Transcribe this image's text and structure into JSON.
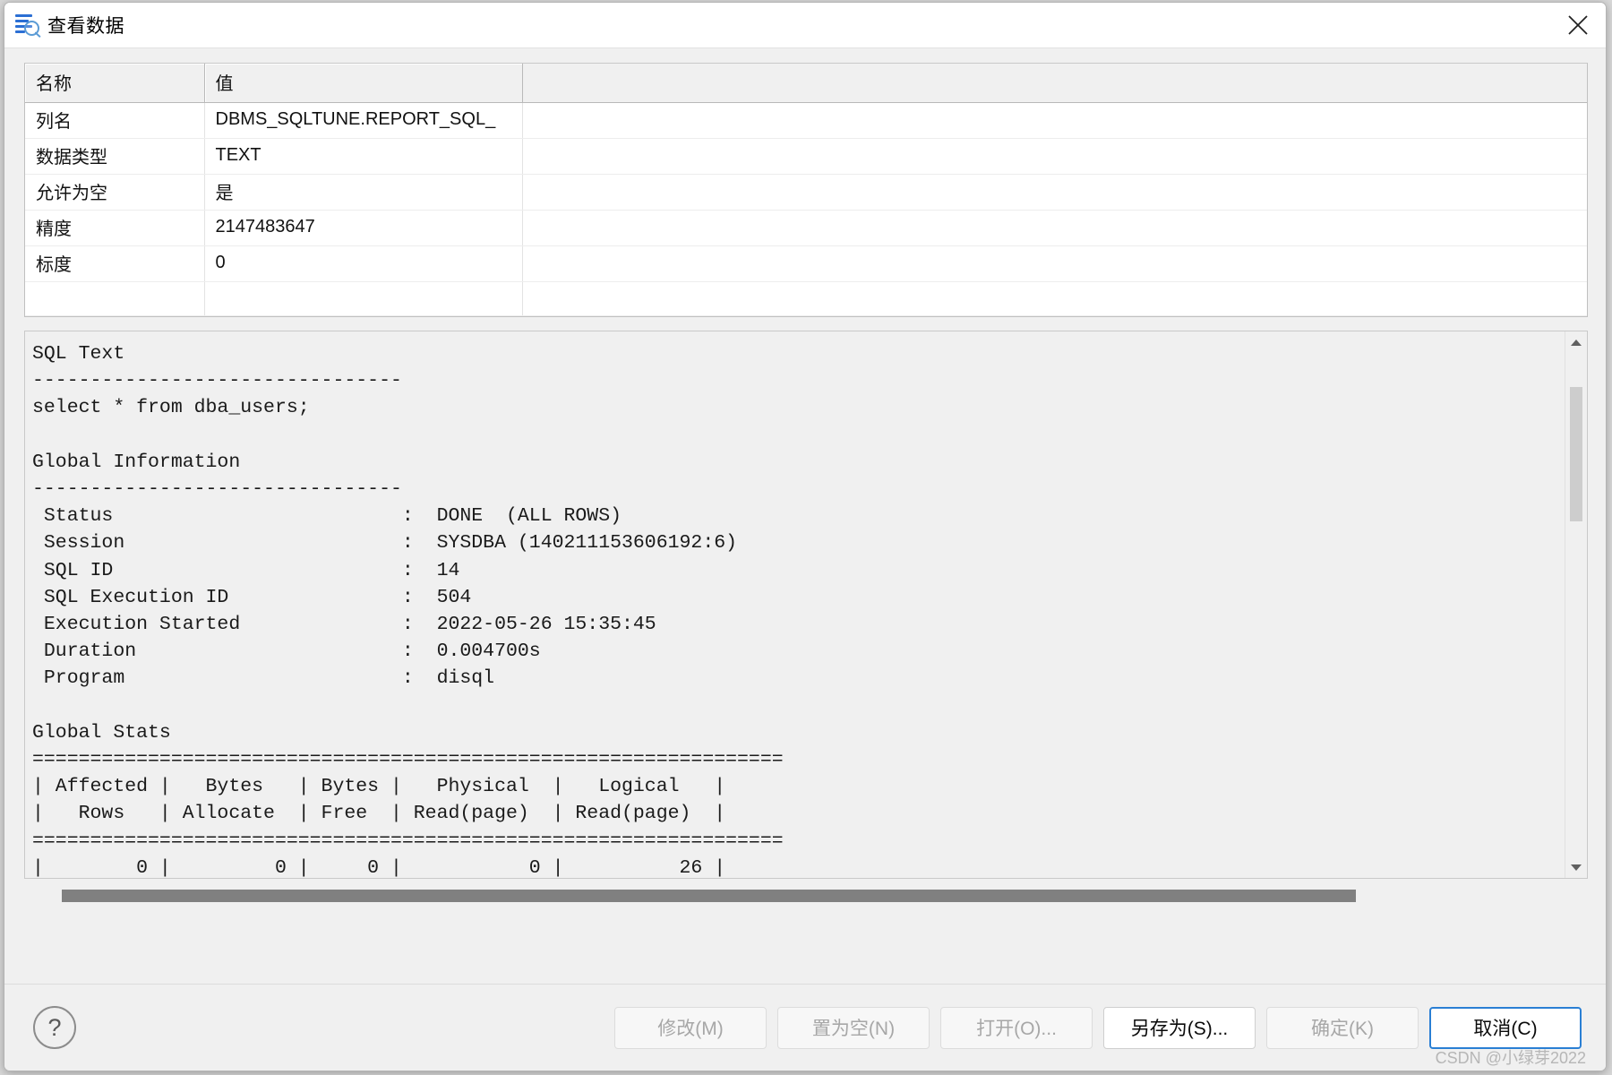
{
  "window": {
    "title": "查看数据",
    "title_icon": "list-search-icon",
    "close_icon": "close-icon"
  },
  "grid": {
    "headers": [
      "名称",
      "值",
      ""
    ],
    "rows": [
      {
        "name": "列名",
        "value": "DBMS_SQLTUNE.REPORT_SQL_"
      },
      {
        "name": "数据类型",
        "value": "TEXT"
      },
      {
        "name": "允许为空",
        "value": "是"
      },
      {
        "name": "精度",
        "value": "2147483647"
      },
      {
        "name": "标度",
        "value": "0"
      }
    ]
  },
  "report": {
    "text": "SQL Text\n--------------------------------\nselect * from dba_users;\n\nGlobal Information\n--------------------------------\n Status                         :  DONE  (ALL ROWS)\n Session                        :  SYSDBA (140211153606192:6)\n SQL ID                         :  14\n SQL Execution ID               :  504\n Execution Started              :  2022-05-26 15:35:45\n Duration                       :  0.004700s\n Program                        :  disql\n\nGlobal Stats\n=================================================================\n| Affected |   Bytes   | Bytes |   Physical  |   Logical   |\n|   Rows   | Allocate  | Free  | Read(page)  | Read(page)  |\n=================================================================\n|        0 |         0 |     0 |           0 |          26 |\n=================================================================",
    "scroll": {
      "up_arrow": "scroll-up-arrow",
      "down_arrow": "scroll-down-arrow"
    }
  },
  "footer": {
    "help_label": "?",
    "buttons": [
      {
        "id": "modify",
        "label": "修改(M)",
        "mnemonic": "M",
        "state": "disabled"
      },
      {
        "id": "setnull",
        "label": "置为空(N)",
        "mnemonic": "N",
        "state": "disabled"
      },
      {
        "id": "open",
        "label": "打开(O)...",
        "mnemonic": "O",
        "state": "disabled"
      },
      {
        "id": "saveas",
        "label": "另存为(S)...",
        "mnemonic": "S",
        "state": "enabled"
      },
      {
        "id": "ok",
        "label": "确定(K)",
        "mnemonic": "K",
        "state": "disabled"
      },
      {
        "id": "cancel",
        "label": "取消(C)",
        "mnemonic": "C",
        "state": "focused"
      }
    ]
  },
  "watermark": "CSDN @小绿芽2022",
  "colors": {
    "accent": "#2a7fd4",
    "icon_blue": "#2b6fd4",
    "disabled_text": "#a7a7a7"
  }
}
